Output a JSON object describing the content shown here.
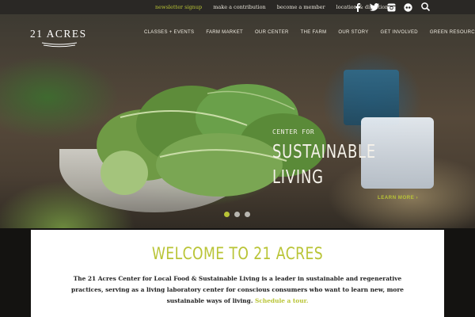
{
  "topbar": {
    "links": [
      {
        "label": "newsletter signup",
        "accent": true
      },
      {
        "label": "make a contribution",
        "accent": false
      },
      {
        "label": "become a member",
        "accent": false
      },
      {
        "label": "location & directions",
        "accent": false
      }
    ],
    "social": [
      {
        "icon": "facebook-icon",
        "glyph": "f"
      },
      {
        "icon": "twitter-icon",
        "glyph": ""
      },
      {
        "icon": "instagram-icon",
        "glyph": ""
      },
      {
        "icon": "flickr-icon",
        "glyph": ""
      }
    ],
    "search_icon": "search-icon"
  },
  "header": {
    "logo_text": "21 ACRES",
    "nav": [
      "CLASSES + EVENTS",
      "FARM MARKET",
      "OUR CENTER",
      "THE FARM",
      "OUR STORY",
      "GET INVOLVED",
      "GREEN RESOURCES"
    ]
  },
  "hero": {
    "small": "CENTER FOR",
    "line1": "SUSTAINABLE",
    "line2": "LIVING",
    "learn_more": "LEARN MORE ›",
    "slide_count": 3,
    "active_slide": 1
  },
  "welcome": {
    "title": "WELCOME TO 21 ACRES",
    "body": "The 21 Acres Center for Local Food & Sustainable Living is a leader in sustainable and regenerative practices, serving as a living laboratory center for conscious consumers who want to learn new, more sustainable ways of living.",
    "link": "Schedule a tour."
  },
  "colors": {
    "accent": "#b9c436",
    "topbar": "#2a2825",
    "text_dark": "#222222"
  }
}
